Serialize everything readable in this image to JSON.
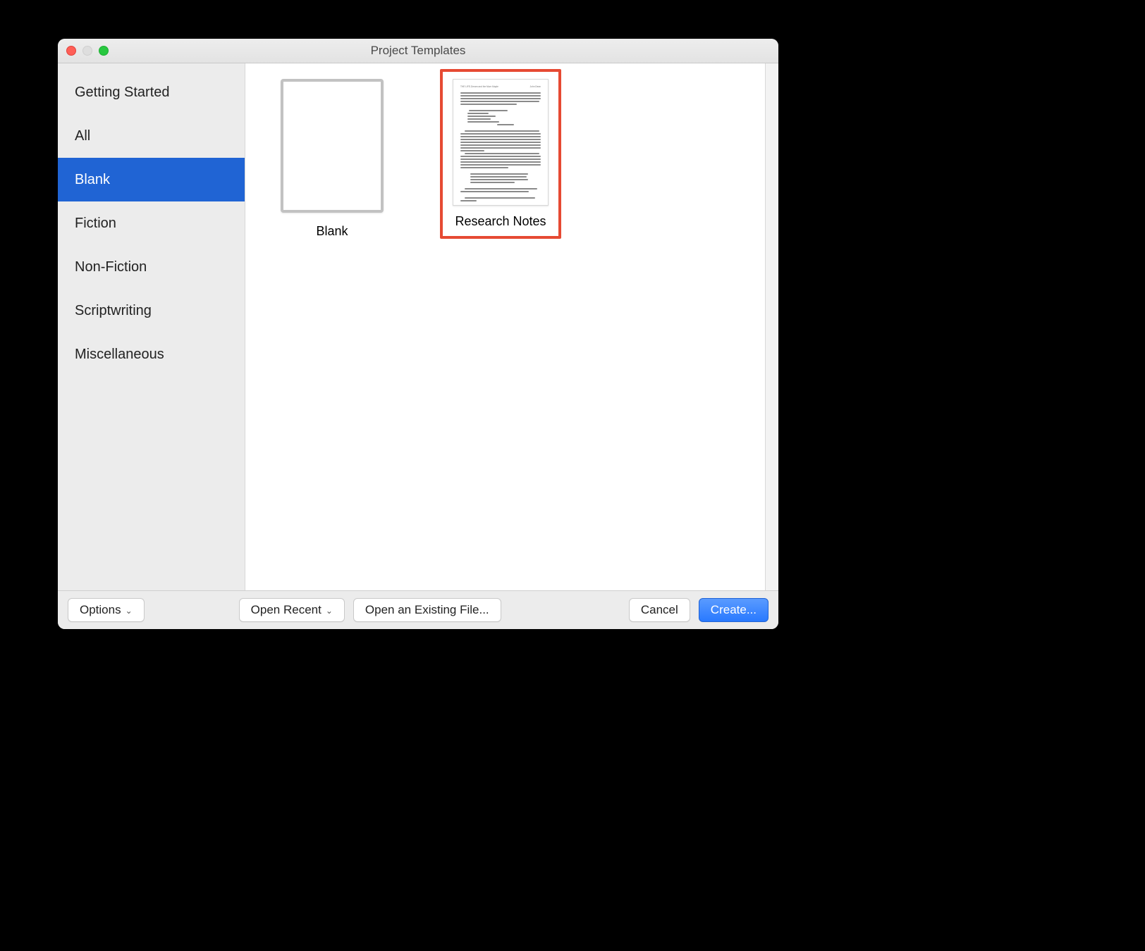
{
  "window": {
    "title": "Project Templates"
  },
  "sidebar": {
    "items": [
      {
        "label": "Getting Started",
        "selected": false
      },
      {
        "label": "All",
        "selected": false
      },
      {
        "label": "Blank",
        "selected": true
      },
      {
        "label": "Fiction",
        "selected": false
      },
      {
        "label": "Non-Fiction",
        "selected": false
      },
      {
        "label": "Scriptwriting",
        "selected": false
      },
      {
        "label": "Miscellaneous",
        "selected": false
      }
    ]
  },
  "templates": [
    {
      "label": "Blank",
      "kind": "blank",
      "highlighted": false
    },
    {
      "label": "Research Notes",
      "kind": "textdoc",
      "highlighted": true
    }
  ],
  "footer": {
    "options_label": "Options",
    "open_recent_label": "Open Recent",
    "open_existing_label": "Open an Existing File...",
    "cancel_label": "Cancel",
    "create_label": "Create..."
  }
}
